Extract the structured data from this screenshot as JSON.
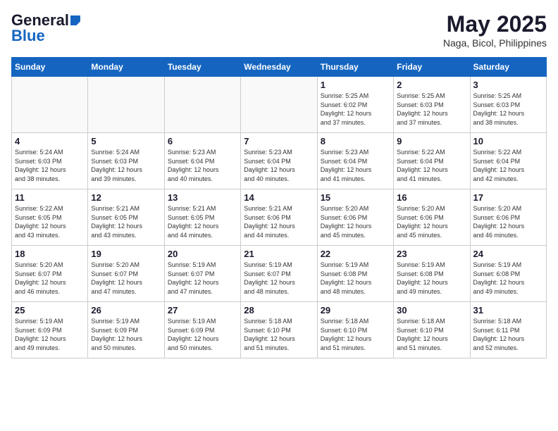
{
  "header": {
    "logo_line1": "General",
    "logo_line2": "Blue",
    "month": "May 2025",
    "location": "Naga, Bicol, Philippines"
  },
  "weekdays": [
    "Sunday",
    "Monday",
    "Tuesday",
    "Wednesday",
    "Thursday",
    "Friday",
    "Saturday"
  ],
  "weeks": [
    [
      {
        "day": "",
        "info": ""
      },
      {
        "day": "",
        "info": ""
      },
      {
        "day": "",
        "info": ""
      },
      {
        "day": "",
        "info": ""
      },
      {
        "day": "1",
        "info": "Sunrise: 5:25 AM\nSunset: 6:02 PM\nDaylight: 12 hours\nand 37 minutes."
      },
      {
        "day": "2",
        "info": "Sunrise: 5:25 AM\nSunset: 6:03 PM\nDaylight: 12 hours\nand 37 minutes."
      },
      {
        "day": "3",
        "info": "Sunrise: 5:25 AM\nSunset: 6:03 PM\nDaylight: 12 hours\nand 38 minutes."
      }
    ],
    [
      {
        "day": "4",
        "info": "Sunrise: 5:24 AM\nSunset: 6:03 PM\nDaylight: 12 hours\nand 38 minutes."
      },
      {
        "day": "5",
        "info": "Sunrise: 5:24 AM\nSunset: 6:03 PM\nDaylight: 12 hours\nand 39 minutes."
      },
      {
        "day": "6",
        "info": "Sunrise: 5:23 AM\nSunset: 6:04 PM\nDaylight: 12 hours\nand 40 minutes."
      },
      {
        "day": "7",
        "info": "Sunrise: 5:23 AM\nSunset: 6:04 PM\nDaylight: 12 hours\nand 40 minutes."
      },
      {
        "day": "8",
        "info": "Sunrise: 5:23 AM\nSunset: 6:04 PM\nDaylight: 12 hours\nand 41 minutes."
      },
      {
        "day": "9",
        "info": "Sunrise: 5:22 AM\nSunset: 6:04 PM\nDaylight: 12 hours\nand 41 minutes."
      },
      {
        "day": "10",
        "info": "Sunrise: 5:22 AM\nSunset: 6:04 PM\nDaylight: 12 hours\nand 42 minutes."
      }
    ],
    [
      {
        "day": "11",
        "info": "Sunrise: 5:22 AM\nSunset: 6:05 PM\nDaylight: 12 hours\nand 43 minutes."
      },
      {
        "day": "12",
        "info": "Sunrise: 5:21 AM\nSunset: 6:05 PM\nDaylight: 12 hours\nand 43 minutes."
      },
      {
        "day": "13",
        "info": "Sunrise: 5:21 AM\nSunset: 6:05 PM\nDaylight: 12 hours\nand 44 minutes."
      },
      {
        "day": "14",
        "info": "Sunrise: 5:21 AM\nSunset: 6:06 PM\nDaylight: 12 hours\nand 44 minutes."
      },
      {
        "day": "15",
        "info": "Sunrise: 5:20 AM\nSunset: 6:06 PM\nDaylight: 12 hours\nand 45 minutes."
      },
      {
        "day": "16",
        "info": "Sunrise: 5:20 AM\nSunset: 6:06 PM\nDaylight: 12 hours\nand 45 minutes."
      },
      {
        "day": "17",
        "info": "Sunrise: 5:20 AM\nSunset: 6:06 PM\nDaylight: 12 hours\nand 46 minutes."
      }
    ],
    [
      {
        "day": "18",
        "info": "Sunrise: 5:20 AM\nSunset: 6:07 PM\nDaylight: 12 hours\nand 46 minutes."
      },
      {
        "day": "19",
        "info": "Sunrise: 5:20 AM\nSunset: 6:07 PM\nDaylight: 12 hours\nand 47 minutes."
      },
      {
        "day": "20",
        "info": "Sunrise: 5:19 AM\nSunset: 6:07 PM\nDaylight: 12 hours\nand 47 minutes."
      },
      {
        "day": "21",
        "info": "Sunrise: 5:19 AM\nSunset: 6:07 PM\nDaylight: 12 hours\nand 48 minutes."
      },
      {
        "day": "22",
        "info": "Sunrise: 5:19 AM\nSunset: 6:08 PM\nDaylight: 12 hours\nand 48 minutes."
      },
      {
        "day": "23",
        "info": "Sunrise: 5:19 AM\nSunset: 6:08 PM\nDaylight: 12 hours\nand 49 minutes."
      },
      {
        "day": "24",
        "info": "Sunrise: 5:19 AM\nSunset: 6:08 PM\nDaylight: 12 hours\nand 49 minutes."
      }
    ],
    [
      {
        "day": "25",
        "info": "Sunrise: 5:19 AM\nSunset: 6:09 PM\nDaylight: 12 hours\nand 49 minutes."
      },
      {
        "day": "26",
        "info": "Sunrise: 5:19 AM\nSunset: 6:09 PM\nDaylight: 12 hours\nand 50 minutes."
      },
      {
        "day": "27",
        "info": "Sunrise: 5:19 AM\nSunset: 6:09 PM\nDaylight: 12 hours\nand 50 minutes."
      },
      {
        "day": "28",
        "info": "Sunrise: 5:18 AM\nSunset: 6:10 PM\nDaylight: 12 hours\nand 51 minutes."
      },
      {
        "day": "29",
        "info": "Sunrise: 5:18 AM\nSunset: 6:10 PM\nDaylight: 12 hours\nand 51 minutes."
      },
      {
        "day": "30",
        "info": "Sunrise: 5:18 AM\nSunset: 6:10 PM\nDaylight: 12 hours\nand 51 minutes."
      },
      {
        "day": "31",
        "info": "Sunrise: 5:18 AM\nSunset: 6:11 PM\nDaylight: 12 hours\nand 52 minutes."
      }
    ]
  ]
}
